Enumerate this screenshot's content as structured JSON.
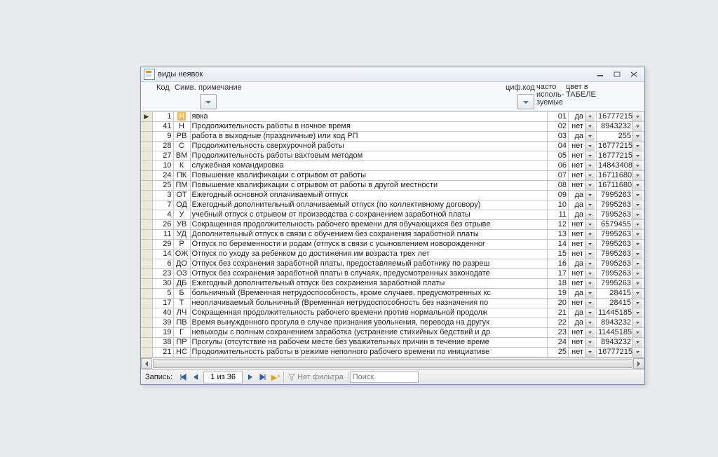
{
  "window": {
    "title": "виды неявок"
  },
  "headers": {
    "kod": "Код",
    "symv": "Симв.",
    "note": "примечание",
    "cif": "циф.код",
    "chasto": "часто исполь- зуемые",
    "tsvet": "цвет в ТАБЕЛЕ"
  },
  "rows": [
    {
      "sel": true,
      "kod": "1",
      "sym": "Я",
      "sym_hl": true,
      "note": "явка",
      "cif": "01",
      "cha": "да",
      "col": "16777215"
    },
    {
      "kod": "41",
      "sym": "Н",
      "note": "Продолжительность работы в ночное время",
      "cif": "02",
      "cha": "нет",
      "col": "8943232"
    },
    {
      "kod": "9",
      "sym": "РВ",
      "note": "работа в выходные (праздничные) или код РП",
      "cif": "03",
      "cha": "да",
      "col": "255"
    },
    {
      "kod": "28",
      "sym": "С",
      "note": "Продолжительность сверхурочной работы",
      "cif": "04",
      "cha": "нет",
      "col": "16777215"
    },
    {
      "kod": "27",
      "sym": "ВМ",
      "note": "Продолжительность работы вахтовым методом",
      "cif": "05",
      "cha": "нет",
      "col": "16777215"
    },
    {
      "kod": "10",
      "sym": "К",
      "note": "служебная командировка",
      "cif": "06",
      "cha": "нет",
      "col": "14843408"
    },
    {
      "kod": "24",
      "sym": "ПК",
      "note": "Повышение квалификации с отрывом от работы",
      "cif": "07",
      "cha": "нет",
      "col": "16711680"
    },
    {
      "kod": "25",
      "sym": "ПМ",
      "note": "Повышение квалификации с отрывом от работы в другой местности",
      "cif": "08",
      "cha": "нет",
      "col": "16711680"
    },
    {
      "kod": "3",
      "sym": "ОТ",
      "note": "Ежегодный основной оплачиваемый отпуск",
      "cif": "09",
      "cha": "да",
      "col": "7995263"
    },
    {
      "kod": "7",
      "sym": "ОД",
      "note": "Ежегодный дополнительный оплачиваемый отпуск (по коллективному договору)",
      "cif": "10",
      "cha": "да",
      "col": "7995263"
    },
    {
      "kod": "4",
      "sym": "У",
      "note": "учебный отпуск с отрывом от производства с сохранением заработной платы",
      "cif": "11",
      "cha": "да",
      "col": "7995263"
    },
    {
      "kod": "26",
      "sym": "УВ",
      "note": "Сокращенная продолжительность рабочего времени для обучающихся без отрывe",
      "cif": "12",
      "cha": "нет",
      "col": "6579455"
    },
    {
      "kod": "11",
      "sym": "УД",
      "note": "Дополнительный отпуск в связи с обучением без сохранения заработной платы",
      "cif": "13",
      "cha": "нет",
      "col": "7995263"
    },
    {
      "kod": "29",
      "sym": "Р",
      "note": "Отпуск по беременности и родам (отпуск в связи с усыновлением новорожденног",
      "cif": "14",
      "cha": "нет",
      "col": "7995263"
    },
    {
      "kod": "14",
      "sym": "ОЖ",
      "note": "Отпуск по уходу за ребенком до достижения им возраста трех лет",
      "cif": "15",
      "cha": "нет",
      "col": "7995263"
    },
    {
      "kod": "6",
      "sym": "ДО",
      "note": "Отпуск без сохранения заработной платы, предоставляемый работнику по разреш",
      "cif": "16",
      "cha": "да",
      "col": "7995263"
    },
    {
      "kod": "23",
      "sym": "ОЗ",
      "note": "Отпуск без сохранения заработной платы в случаях, предусмотренных законодате",
      "cif": "17",
      "cha": "нет",
      "col": "7995263"
    },
    {
      "kod": "30",
      "sym": "ДБ",
      "note": "Ежегодный дополнительный отпуск без сохранения заработной платы",
      "cif": "18",
      "cha": "нет",
      "col": "7995263"
    },
    {
      "kod": "5",
      "sym": "Б",
      "note": "больничный (Временная нетрудоспособность, кроме случаев, предусмотренных кc",
      "cif": "19",
      "cha": "да",
      "col": "28415"
    },
    {
      "kod": "17",
      "sym": "Т",
      "note": "неоплачиваемый больничный (Временная нетрудоспособность без назначения по",
      "cif": "20",
      "cha": "нет",
      "col": "28415"
    },
    {
      "kod": "40",
      "sym": "ЛЧ",
      "note": "Сокращенная продолжительность рабочего времени против нормальной продолж",
      "cif": "21",
      "cha": "да",
      "col": "11445185"
    },
    {
      "kod": "39",
      "sym": "ПВ",
      "note": "Время вынужденного прогула в случае признания увольнения, перевода на другук",
      "cif": "22",
      "cha": "да",
      "col": "8943232"
    },
    {
      "kod": "19",
      "sym": "Г",
      "note": "невыходы с полным сохранением заработка (устранение стихийных бедствий и др",
      "cif": "23",
      "cha": "нет",
      "col": "11445185"
    },
    {
      "kod": "38",
      "sym": "ПР",
      "note": "Прогулы (отсутствие на рабочем месте без уважительных причин в течение време",
      "cif": "24",
      "cha": "нет",
      "col": "8943232"
    },
    {
      "kod": "21",
      "sym": "НС",
      "note": "Продолжительность работы в режиме неполного рабочего времени по инициативе",
      "cif": "25",
      "cha": "нет",
      "col": "16777215"
    }
  ],
  "nav": {
    "record_label": "Запись:",
    "record_of": "1 из 36",
    "no_filter": "Нет фильтра",
    "search_placeholder": "Поиск"
  }
}
